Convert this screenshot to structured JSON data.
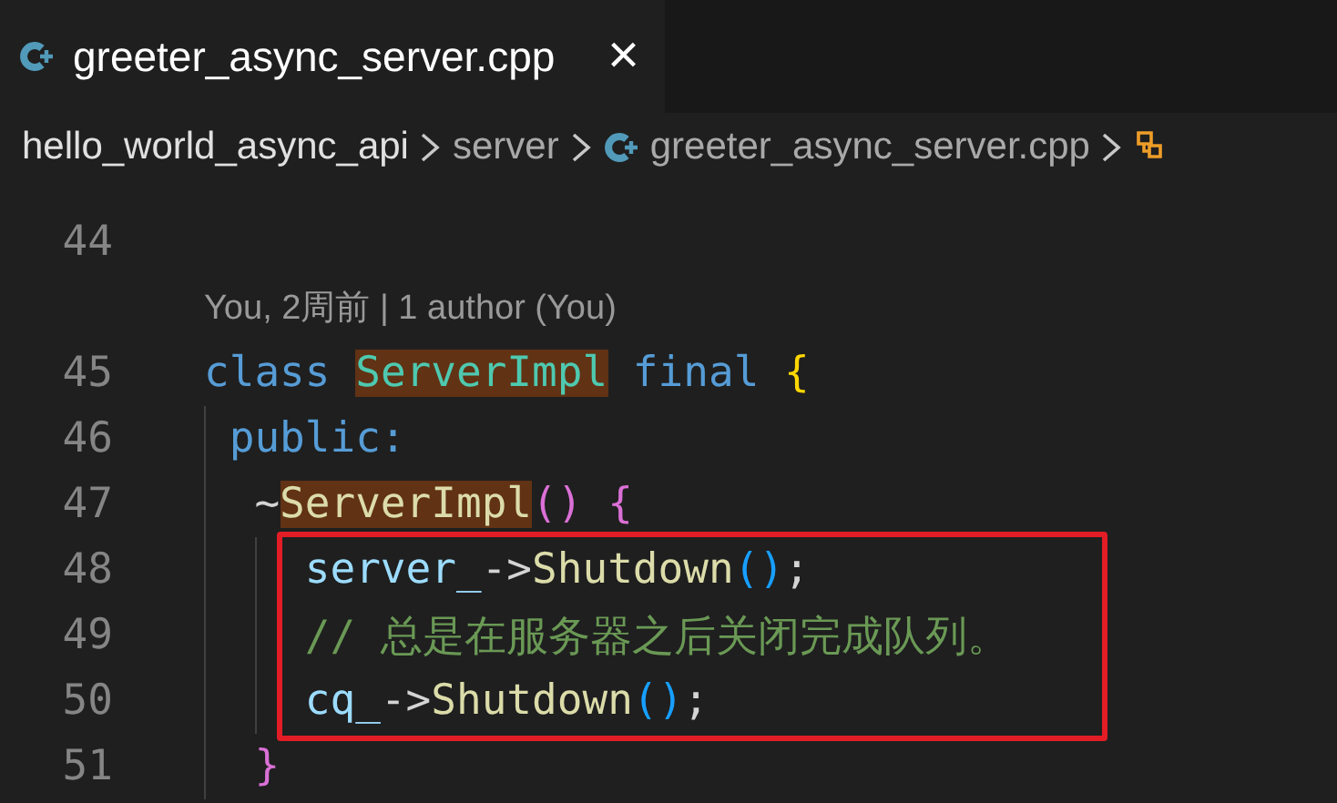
{
  "tabs": [
    {
      "label": "greeter_async_server.cpp",
      "selected": true,
      "close": "×"
    }
  ],
  "breadcrumb": [
    {
      "label": "hello_world_async_api",
      "kind": "folder"
    },
    {
      "label": "server",
      "kind": "folder"
    },
    {
      "label": "greeter_async_server.cpp",
      "kind": "file"
    }
  ],
  "lines": [
    {
      "kind": "code",
      "number": "44"
    },
    {
      "kind": "codelens",
      "text": "You, 2周前 | 1 author (You)"
    },
    {
      "kind": "code",
      "number": "45",
      "tokens": [
        {
          "text": "class ",
          "kind": "keyword"
        },
        {
          "text": "ServerImpl",
          "kind": "type",
          "highlighted": true
        },
        {
          "text": " final ",
          "kind": "keyword"
        },
        {
          "text": "{",
          "kind": "bracket1"
        }
      ]
    },
    {
      "kind": "code",
      "number": "46",
      "tokens": [
        {
          "text": " public:",
          "kind": "keyword"
        }
      ]
    },
    {
      "kind": "code",
      "number": "47",
      "tokens": [
        {
          "text": "  ~",
          "kind": "plain"
        },
        {
          "text": "ServerImpl",
          "kind": "func",
          "highlighted": true
        },
        {
          "text": "() {",
          "kind": "bracket2"
        }
      ]
    },
    {
      "kind": "code",
      "number": "48",
      "boxed": true,
      "tokens": [
        {
          "text": "    server_",
          "kind": "var"
        },
        {
          "text": "->",
          "kind": "plain"
        },
        {
          "text": "Shutdown",
          "kind": "func"
        },
        {
          "text": "()",
          "kind": "bracket3"
        },
        {
          "text": ";",
          "kind": "plain"
        }
      ]
    },
    {
      "kind": "code",
      "number": "49",
      "boxed": true,
      "tokens": [
        {
          "text": "    // 总是在服务器之后关闭完成队列。",
          "kind": "comment"
        }
      ]
    },
    {
      "kind": "code",
      "number": "50",
      "boxed": true,
      "tokens": [
        {
          "text": "    cq_",
          "kind": "var"
        },
        {
          "text": "->",
          "kind": "plain"
        },
        {
          "text": "Shutdown",
          "kind": "func"
        },
        {
          "text": "()",
          "kind": "bracket3"
        },
        {
          "text": ";",
          "kind": "plain"
        }
      ]
    },
    {
      "kind": "code",
      "number": "51",
      "tokens": [
        {
          "text": "  }",
          "kind": "bracket2"
        }
      ]
    }
  ]
}
